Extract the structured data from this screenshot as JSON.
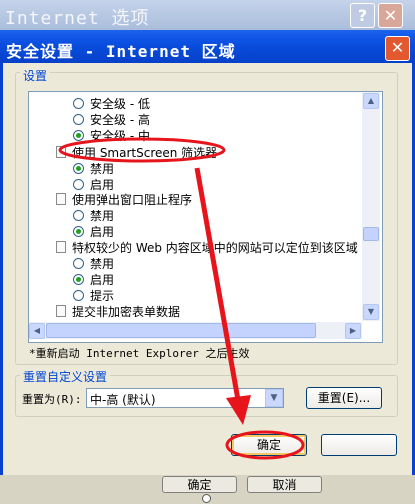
{
  "outer_window": {
    "title": "Internet 选项"
  },
  "dialog": {
    "title": "安全设置 - Internet 区域",
    "settings_group_label": "设置",
    "settings_items": [
      {
        "kind": "radio",
        "label": "安全级 - 低",
        "checked": false
      },
      {
        "kind": "radio",
        "label": "安全级 - 高",
        "checked": false
      },
      {
        "kind": "radio",
        "label": "安全级 - 中",
        "checked": true
      },
      {
        "kind": "heading",
        "label": "使用 SmartScreen 筛选器"
      },
      {
        "kind": "radio",
        "label": "禁用",
        "checked": true
      },
      {
        "kind": "radio",
        "label": "启用",
        "checked": false
      },
      {
        "kind": "heading",
        "label": "使用弹出窗口阻止程序"
      },
      {
        "kind": "radio",
        "label": "禁用",
        "checked": false
      },
      {
        "kind": "radio",
        "label": "启用",
        "checked": true
      },
      {
        "kind": "heading",
        "label": "特权较少的 Web 内容区域中的网站可以定位到该区域"
      },
      {
        "kind": "radio",
        "label": "禁用",
        "checked": false
      },
      {
        "kind": "radio",
        "label": "启用",
        "checked": true
      },
      {
        "kind": "radio",
        "label": "提示",
        "checked": false
      },
      {
        "kind": "heading",
        "label": "提交非加密表单数据"
      }
    ],
    "restart_note": "*重新启动 Internet Explorer 之后生效",
    "reset_group_label": "重置自定义设置",
    "reset_to_label": "重置为(R):",
    "reset_level_value": "中-高 (默认)",
    "reset_button": "重置(E)...",
    "ok_button": "确定",
    "cancel_button": ""
  },
  "underlying_buttons": {
    "ok": "确定",
    "cancel": "取消"
  },
  "annotation_color": "#e8141c"
}
